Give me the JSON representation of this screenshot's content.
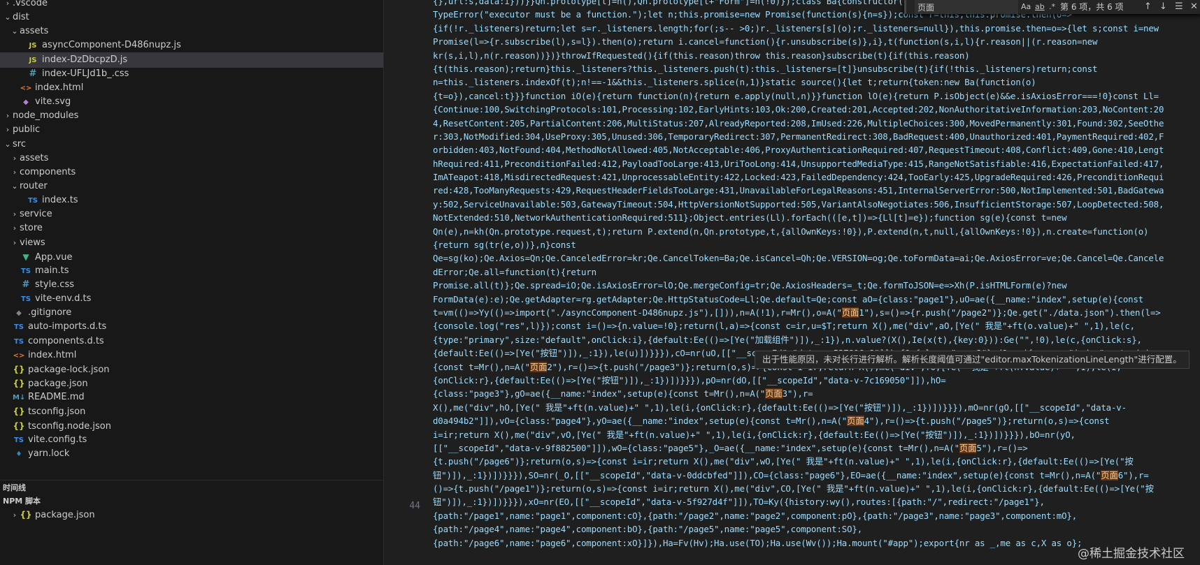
{
  "explorer": {
    "items": [
      {
        "label": ".vscode",
        "kind": "folder",
        "open": false,
        "indent": 0
      },
      {
        "label": "dist",
        "kind": "folder",
        "open": true,
        "indent": 0
      },
      {
        "label": "assets",
        "kind": "folder",
        "open": true,
        "indent": 1
      },
      {
        "label": "asyncComponent-D486nupz.js",
        "kind": "js",
        "indent": 2
      },
      {
        "label": "index-DzDbcpzD.js",
        "kind": "js",
        "indent": 2,
        "selected": true
      },
      {
        "label": "index-UFLJd1b_.css",
        "kind": "css",
        "indent": 2
      },
      {
        "label": "index.html",
        "kind": "html",
        "indent": 1
      },
      {
        "label": "vite.svg",
        "kind": "svg",
        "indent": 1
      },
      {
        "label": "node_modules",
        "kind": "folder",
        "open": false,
        "indent": 0
      },
      {
        "label": "public",
        "kind": "folder",
        "open": false,
        "indent": 0
      },
      {
        "label": "src",
        "kind": "folder",
        "open": true,
        "indent": 0
      },
      {
        "label": "assets",
        "kind": "folder",
        "open": false,
        "indent": 1
      },
      {
        "label": "components",
        "kind": "folder",
        "open": false,
        "indent": 1
      },
      {
        "label": "router",
        "kind": "folder",
        "open": true,
        "indent": 1
      },
      {
        "label": "index.ts",
        "kind": "ts",
        "indent": 2
      },
      {
        "label": "service",
        "kind": "folder",
        "open": false,
        "indent": 1
      },
      {
        "label": "store",
        "kind": "folder",
        "open": false,
        "indent": 1
      },
      {
        "label": "views",
        "kind": "folder",
        "open": false,
        "indent": 1
      },
      {
        "label": "App.vue",
        "kind": "vue",
        "indent": 1
      },
      {
        "label": "main.ts",
        "kind": "ts",
        "indent": 1
      },
      {
        "label": "style.css",
        "kind": "css",
        "indent": 1
      },
      {
        "label": "vite-env.d.ts",
        "kind": "ts",
        "indent": 1
      },
      {
        "label": ".gitignore",
        "kind": "git",
        "indent": 0
      },
      {
        "label": "auto-imports.d.ts",
        "kind": "ts",
        "indent": 0
      },
      {
        "label": "components.d.ts",
        "kind": "ts",
        "indent": 0
      },
      {
        "label": "index.html",
        "kind": "html",
        "indent": 0
      },
      {
        "label": "package-lock.json",
        "kind": "json",
        "indent": 0
      },
      {
        "label": "package.json",
        "kind": "json",
        "indent": 0
      },
      {
        "label": "README.md",
        "kind": "md",
        "indent": 0
      },
      {
        "label": "tsconfig.json",
        "kind": "json",
        "indent": 0
      },
      {
        "label": "tsconfig.node.json",
        "kind": "json",
        "indent": 0
      },
      {
        "label": "vite.config.ts",
        "kind": "ts",
        "indent": 0
      },
      {
        "label": "yarn.lock",
        "kind": "yarn",
        "indent": 0
      }
    ]
  },
  "sections": {
    "timeline": "时间线",
    "npm_scripts": "NPM 脚本",
    "npm_item": "package.json"
  },
  "find": {
    "value": "页面",
    "match_case": "Aa",
    "whole_word": "ab",
    "regex": ".*",
    "count": "第 6 项，共 6 项"
  },
  "editor": {
    "line_number": "44",
    "highlight_term": "页面",
    "code_lines": [
      "{},url:s,data:i}))}}Qn.prototype[t]=n(),Qn.prototype[t+\"Form\"]=n(!0)});class Ba{constructor(",
      "TypeError(\"executor must be a function.\");let n;this.promise=new Promise(function(s){n=s});const r=this;this.promise.then(o=>",
      "{if(!r._listeners)return;let s=r._listeners.length;for(;s-- >0;)r._listeners[s](o);r._listeners=null}),this.promise.then=o=>{let s;const i=new",
      "Promise(l=>{r.subscribe(l),s=l}).then(o);return i.cancel=function(){r.unsubscribe(s)},i},t(function(s,i,l){r.reason||(r.reason=new",
      "kr(s,i,l),n(r.reason))})}throwIfRequested(){if(this.reason)throw this.reason}subscribe(t){if(this.reason)",
      "{t(this.reason);return}this._listeners?this._listeners.push(t):this._listeners=[t]}unsubscribe(t){if(!this._listeners)return;const",
      "n=this._listeners.indexOf(t);n!==-1&&this._listeners.splice(n,1)}static source(){let t;return{token:new Ba(function(o)",
      "{t=o}),cancel:t}}}function iO(e){return function(n){return e.apply(null,n)}}function lO(e){return P.isObject(e)&&e.isAxiosError===!0}const Ll=",
      "{Continue:100,SwitchingProtocols:101,Processing:102,EarlyHints:103,Ok:200,Created:201,Accepted:202,NonAuthoritativeInformation:203,NoContent:20",
      "4,ResetContent:205,PartialContent:206,MultiStatus:207,AlreadyReported:208,ImUsed:226,MultipleChoices:300,MovedPermanently:301,Found:302,SeeOthe",
      "r:303,NotModified:304,UseProxy:305,Unused:306,TemporaryRedirect:307,PermanentRedirect:308,BadRequest:400,Unauthorized:401,PaymentRequired:402,F",
      "orbidden:403,NotFound:404,MethodNotAllowed:405,NotAcceptable:406,ProxyAuthenticationRequired:407,RequestTimeout:408,Conflict:409,Gone:410,Lengt",
      "hRequired:411,PreconditionFailed:412,PayloadTooLarge:413,UriTooLong:414,UnsupportedMediaType:415,RangeNotSatisfiable:416,ExpectationFailed:417,",
      "ImATeapot:418,MisdirectedRequest:421,UnprocessableEntity:422,Locked:423,FailedDependency:424,TooEarly:425,UpgradeRequired:426,PreconditionRequi",
      "red:428,TooManyRequests:429,RequestHeaderFieldsTooLarge:431,UnavailableForLegalReasons:451,InternalServerError:500,NotImplemented:501,BadGatewa",
      "y:502,ServiceUnavailable:503,GatewayTimeout:504,HttpVersionNotSupported:505,VariantAlsoNegotiates:506,InsufficientStorage:507,LoopDetected:508,",
      "NotExtended:510,NetworkAuthenticationRequired:511};Object.entries(Ll).forEach(([e,t])=>{Ll[t]=e});function sg(e){const t=new",
      "Qn(e),n=kh(Qn.prototype.request,t);return P.extend(n,Qn.prototype,t,{allOwnKeys:!0}),P.extend(n,t,null,{allOwnKeys:!0}),n.create=function(o)",
      "{return sg(tr(e,o))},n}const",
      "Qe=sg(ko);Qe.Axios=Qn;Qe.CanceledError=kr;Qe.CancelToken=Ba;Qe.isCancel=Qh;Qe.VERSION=og;Qe.toFormData=ai;Qe.AxiosError=ve;Qe.Cancel=Qe.Cancele",
      "dError;Qe.all=function(t){return",
      "Promise.all(t)};Qe.spread=iO;Qe.isAxiosError=lO;Qe.mergeConfig=tr;Qe.AxiosHeaders=_t;Qe.formToJSON=e=>Xh(P.isHTMLForm(e)?new",
      "FormData(e):e);Qe.getAdapter=rg.getAdapter;Qe.HttpStatusCode=Ll;Qe.default=Qe;const aO={class:\"page1\"},uO=ae({__name:\"index\",setup(e){const",
      "t=vm(()=>Yy(()=>import(\"./asyncComponent-D486nupz.js\"),[])),n=A(!1),r=Mr(),o=A(\"页面1\"),s=()=>{r.push(\"/page2\")};Qe.get(\"./data.json\").then(l=>",
      "{console.log(\"res\",l)});const i=()=>{n.value=!0};return(l,a)=>{const c=ir,u=$T;return X(),me(\"div\",aO,[Ye(\" 我是\"+ft(o.value)+\" \",1),le(c,",
      "{type:\"primary\",size:\"default\",onClick:i},{default:Ee(()=>[Ye(\"加载组件\")]),_:1}),n.value?(X(),Ie(x(t),{key:0})):Ge(\"\",!0),le(c,{onClick:s},",
      "{default:Ee(()=>[Ye(\"按钮\")]),_:1}),le(u)])}}}),cO=nr(uO,[[\"__scopeId\",\"data-v-537816e8\"]]),fO={class:\"page2\"},dO=ae({__name:\"index\",setup(e)",
      "{const t=Mr(),n=A(\"页面2\"),r=()=>{t.push(\"/page3\")};return(o,s)=>{const i=ir;return X(),me(\"div\",fO,[Ye(\" 我是\"+ft(n.value)+\" \",1),le(i,",
      "{onClick:r},{default:Ee(()=>[Ye(\"按钮\")]),_:1})])}}}),pO=nr(dO,[[\"__scopeId\",\"data-v-7c169050\"]]),hO=",
      "{class:\"page3\"},gO=ae({__name:\"index\",setup(e){const t=Mr(),n=A(\"页面3\"),r=",
      "X(),me(\"div\",hO,[Ye(\" 我是\"+ft(n.value)+\" \",1),le(i,{onClick:r},{default:Ee(()=>[Ye(\"按钮\")]),_:1})])}}}),mO=nr(gO,[[\"__scopeId\",\"data-v-",
      "d0a494b2\"]]),vO={class:\"page4\"},yO=ae({__name:\"index\",setup(e){const t=Mr(),n=A(\"页面4\"),r=()=>{t.push(\"/page5\")};return(o,s)=>{const",
      "i=ir;return X(),me(\"div\",vO,[Ye(\" 我是\"+ft(n.value)+\" \",1),le(i,{onClick:r},{default:Ee(()=>[Ye(\"按钮\")]),_:1})])}}}),bO=nr(yO,",
      "[[\"__scopeId\",\"data-v-9f882500\"]]),wO={class:\"page5\"},_O=ae({__name:\"index\",setup(e){const t=Mr(),n=A(\"页面5\"),r=()=>",
      "{t.push(\"/page6\")};return(o,s)=>{const i=ir;return X(),me(\"div\",wO,[Ye(\" 我是\"+ft(n.value)+\" \",1),le(i,{onClick:r},{default:Ee(()=>[Ye(\"按",
      "钮\")]),_:1})])}}}),SO=nr(_O,[[\"__scopeId\",\"data-v-0ddcbfed\"]]),CO={class:\"page6\"},EO=ae({__name:\"index\",setup(e){const t=Mr(),n=A(\"页面6\"),r=",
      "()=>{t.push(\"/page1\")};return(o,s)=>{const i=ir;return X(),me(\"div\",CO,[Ye(\" 我是\"+ft(n.value)+\" \",1),le(i,{onClick:r},{default:Ee(()=>[Ye(\"按",
      "钮\")]),_:1})])}}}),xO=nr(EO,[[\"__scopeId\",\"data-v-5f927d4f\"]]),TO=Ky({history:wy(),routes:[{path:\"/\",redirect:\"/page1\"},",
      "{path:\"/page1\",name:\"page1\",component:cO},{path:\"/page2\",name:\"page2\",component:pO},{path:\"/page3\",name:\"page3\",component:mO},",
      "{path:\"/page4\",name:\"page4\",component:bO},{path:\"/page5\",name:\"page5\",component:SO},",
      "{path:\"/page6\",name:\"page6\",component:xO}]}),Ha=Fv(Hv);Ha.use(TO);Ha.use(Wv());Ha.mount(\"#app\");export{nr as _,me as c,X as o};"
    ]
  },
  "tooltip": "出于性能原因，未对长行进行解析。解析长度阈值可通过\"editor.maxTokenizationLineLength\"进行配置。",
  "watermark": "@稀土掘金技术社区"
}
